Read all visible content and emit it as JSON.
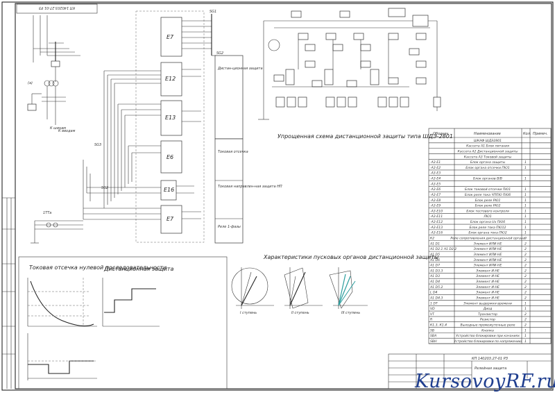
{
  "stamp_top": "КП 140203.27-01 РЗ",
  "title_main": "Упрощенная схема дистанционной защиты типа ШДЭ-2801",
  "title_vectors": "Характеристики пусковых органов дистанционной защиты",
  "title_current": "Токовая отсечка нулевой последовательности",
  "title_distance": "Дистанционная защита",
  "stamp_code": "КП 140203.27-01 РЗ",
  "stamp_caption": "Релейная защита",
  "watermark": "KursovoyRF.ru",
  "blocks": [
    "Е7",
    "Е12",
    "Е13",
    "Е6",
    "Е16",
    "Е7"
  ],
  "sg_labels": [
    "SG1",
    "SG2",
    "SG3",
    "SG2"
  ],
  "side_boxes": [
    "Дистан-ционная защита",
    "Токовая отсечка",
    "Токовая направлен-ная защита НП",
    "Реле 1-фазы"
  ],
  "vector_steps": [
    "I ступень",
    "II ступень",
    "III ступень"
  ],
  "table": {
    "headers": [
      "Обознач.",
      "Наименование",
      "Кол.",
      "Примеч."
    ],
    "rows": [
      [
        "",
        "ШКАФ ШДЭ2801",
        "",
        ""
      ],
      [
        "",
        "Кассета А1 Блок питания",
        "",
        ""
      ],
      [
        "",
        "Кассета А2 Дистанционной защиты",
        "",
        ""
      ],
      [
        "",
        "Кассета А3 Токовой защиты",
        "",
        ""
      ],
      [
        "-А3-Е1",
        "Блок органа защиты",
        "1",
        ""
      ],
      [
        "-А3-Е2",
        "Блок органа отсечки ПЮ1",
        "1",
        ""
      ],
      [
        "-А3-Е3",
        "",
        "",
        ""
      ],
      [
        "-А3-Е4",
        "Блок органов В/В",
        "1",
        ""
      ],
      [
        "-А3-Е5",
        "",
        "",
        ""
      ],
      [
        "-А3-Е6",
        "Блок токовой отсечки ПЮ1",
        "1",
        ""
      ],
      [
        "-А3-Е7",
        "Блок реле тока ЧППЮ ПЮ6",
        "1",
        ""
      ],
      [
        "-А3-Е8",
        "Блок реле РЮ1",
        "1",
        ""
      ],
      [
        "-А3-Е9",
        "Блок реле РЮ2",
        "1",
        ""
      ],
      [
        "-А3-Е10",
        "Блок тестового контроля",
        "1",
        ""
      ],
      [
        "-А3-Е11",
        "ЛЮ1",
        "1",
        ""
      ],
      [
        "-А3-Е12",
        "Блок органа Ux ПЮ6",
        "1",
        ""
      ],
      [
        "-А3-Е13",
        "Блок реле тока ПЮ12",
        "1",
        ""
      ],
      [
        "-А3-Е16",
        "Блок органа тока ПЮ2",
        "1",
        ""
      ],
      [
        "К2",
        "Реле сопротивления дистанционной органа",
        "9",
        ""
      ],
      [
        "А1 D1",
        "Элемент ИЛИ-НЕ",
        "2",
        ""
      ],
      [
        "А1 D2.1 А1 D2.2",
        "Элемент ИЛИ-НЕ",
        "2",
        ""
      ],
      [
        "А1 D5",
        "Элемент ИЛИ-НЕ",
        "2",
        ""
      ],
      [
        "А1 D6",
        "Элемент ИЛИ-НЕ",
        "2",
        ""
      ],
      [
        "А1 D7",
        "Элемент ИЛИ-НЕ",
        "2",
        ""
      ],
      [
        "А1 D3.3",
        "Элемент И-НЕ",
        "2",
        ""
      ],
      [
        "А1 D3",
        "Элемент И-НЕ",
        "2",
        ""
      ],
      [
        "А1 D4",
        "Элемент И-НЕ",
        "2",
        ""
      ],
      [
        "А1 D5.2",
        "Элемент И-НЕ",
        "2",
        ""
      ],
      [
        "L D4",
        "Элемент И-НЕ",
        "2",
        ""
      ],
      [
        "А1 D4.3",
        "Элемент И-НЕ",
        "2",
        ""
      ],
      [
        "1 DT",
        "Элемент выдержки времени",
        "1",
        ""
      ],
      [
        "VD",
        "Диод",
        "1",
        ""
      ],
      [
        "VT",
        "Транзистор",
        "2",
        ""
      ],
      [
        "R",
        "Резистор",
        "2",
        ""
      ],
      [
        "К1.3, К1.4",
        "Выходные промежуточные реле",
        "2",
        ""
      ],
      [
        "SB",
        "Кнопка",
        "1",
        ""
      ],
      [
        "SBA",
        "Устройство блокировки при качаниях",
        "1",
        ""
      ],
      [
        "SBH",
        "Устройство блокировки по напряжению",
        "1",
        ""
      ]
    ]
  }
}
